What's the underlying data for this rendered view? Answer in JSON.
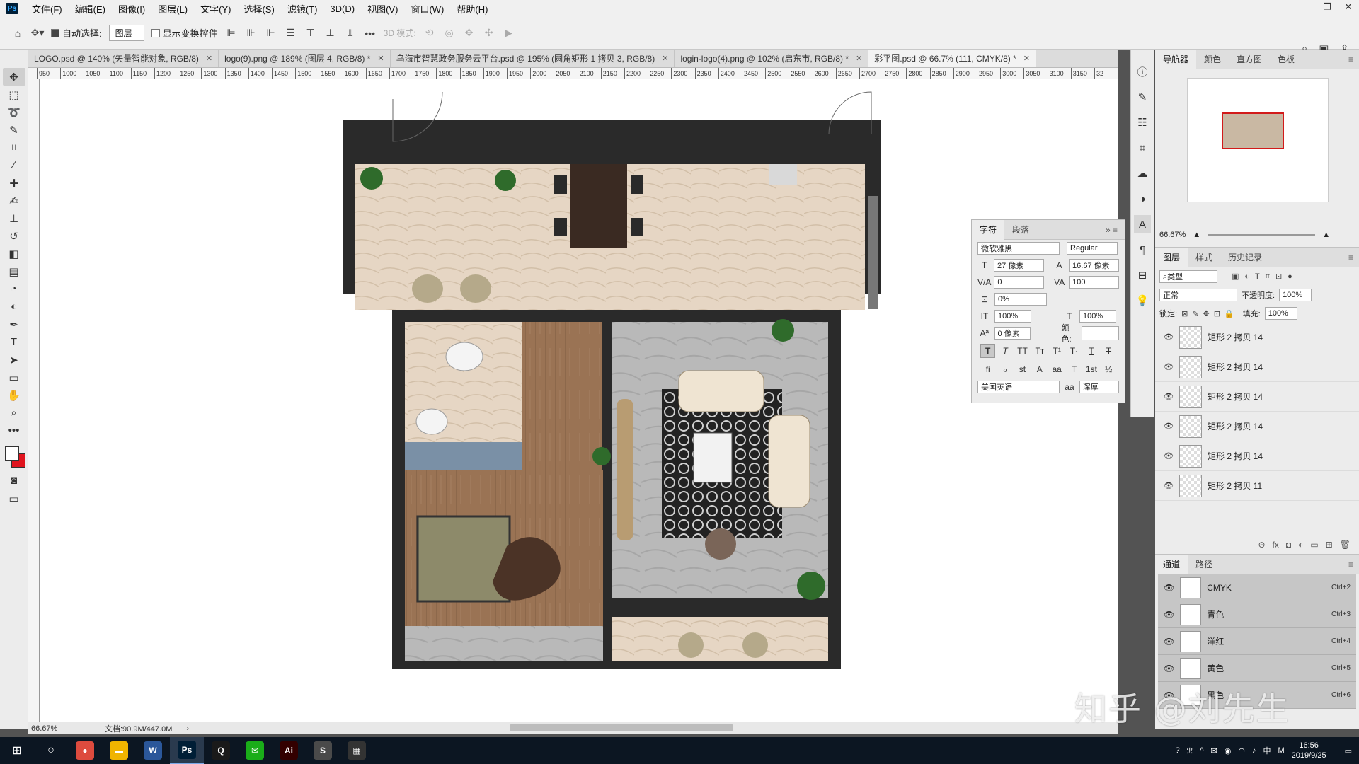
{
  "menubar": {
    "items": [
      "文件(F)",
      "编辑(E)",
      "图像(I)",
      "图层(L)",
      "文字(Y)",
      "选择(S)",
      "滤镜(T)",
      "3D(D)",
      "视图(V)",
      "窗口(W)",
      "帮助(H)"
    ]
  },
  "optionsbar": {
    "auto_select_label": "自动选择:",
    "auto_select_value": "图层",
    "show_transform_label": "显示变换控件",
    "mode_3d_label": "3D 模式:"
  },
  "doc_tabs": [
    {
      "label": "LOGO.psd @ 140% (矢量智能对象, RGB/8)"
    },
    {
      "label": "logo(9).png @ 189% (图层 4, RGB/8) *"
    },
    {
      "label": "乌海市智慧政务服务云平台.psd @ 195% (圆角矩形 1 拷贝 3, RGB/8)"
    },
    {
      "label": "login-logo(4).png @ 102% (启东市, RGB/8) *"
    },
    {
      "label": "彩平图.psd @ 66.7% (111, CMYK/8) *"
    }
  ],
  "ruler_labels": [
    "950",
    "1000",
    "1050",
    "1100",
    "1150",
    "1200",
    "1250",
    "1300",
    "1350",
    "1400",
    "1450",
    "1500",
    "1550",
    "1600",
    "1650",
    "1700",
    "1750",
    "1800",
    "1850",
    "1900",
    "1950",
    "2000",
    "2050",
    "2100",
    "2150",
    "2200",
    "2250",
    "2300",
    "2350",
    "2400",
    "2450",
    "2500",
    "2550",
    "2600",
    "2650",
    "2700",
    "2750",
    "2800",
    "2850",
    "2900",
    "2950",
    "3000",
    "3050",
    "3100",
    "3150",
    "32"
  ],
  "status": {
    "zoom": "66.67%",
    "doc": "文档:90.9M/447.0M"
  },
  "character_panel": {
    "tabs": [
      "字符",
      "段落"
    ],
    "font_family": "微软雅黑",
    "font_style": "Regular",
    "font_size": "27 像素",
    "leading": "16.67 像素",
    "kerning": "0",
    "tracking": "100",
    "scale_pct": "0%",
    "vscale": "100%",
    "hscale": "100%",
    "baseline": "0 像素",
    "color_label": "颜色:",
    "language": "美国英语",
    "antialias_icon": "aa",
    "antialias": "浑厚"
  },
  "navigator": {
    "tabs": [
      "导航器",
      "颜色",
      "直方图",
      "色板"
    ],
    "zoom": "66.67%"
  },
  "layers_panel": {
    "tabs": [
      "图层",
      "样式",
      "历史记录"
    ],
    "filter": "类型",
    "blend": "正常",
    "opacity_label": "不透明度:",
    "opacity": "100%",
    "lock_label": "锁定:",
    "fill_label": "填充:",
    "fill": "100%",
    "layers": [
      {
        "name": "矩形 2 拷贝 14"
      },
      {
        "name": "矩形 2 拷贝 14"
      },
      {
        "name": "矩形 2 拷贝 14"
      },
      {
        "name": "矩形 2 拷贝 14"
      },
      {
        "name": "矩形 2 拷贝 14"
      },
      {
        "name": "矩形 2 拷贝 11"
      }
    ]
  },
  "channels_panel": {
    "tabs": [
      "通道",
      "路径"
    ],
    "channels": [
      {
        "name": "CMYK",
        "shortcut": "Ctrl+2"
      },
      {
        "name": "青色",
        "shortcut": "Ctrl+3"
      },
      {
        "name": "洋红",
        "shortcut": "Ctrl+4"
      },
      {
        "name": "黄色",
        "shortcut": "Ctrl+5"
      },
      {
        "name": "黑色",
        "shortcut": "Ctrl+6"
      }
    ]
  },
  "taskbar": {
    "apps": [
      {
        "name": "chrome",
        "glyph": "●",
        "color": "#dd4b3e"
      },
      {
        "name": "explorer",
        "glyph": "▬",
        "color": "#f0b400"
      },
      {
        "name": "word",
        "glyph": "W",
        "color": "#2b579a"
      },
      {
        "name": "photoshop",
        "glyph": "Ps",
        "color": "#001e36"
      },
      {
        "name": "qq",
        "glyph": "Q",
        "color": "#1a1a1a"
      },
      {
        "name": "wechat",
        "glyph": "✉",
        "color": "#1aad19"
      },
      {
        "name": "illustrator",
        "glyph": "Ai",
        "color": "#330000"
      },
      {
        "name": "sublime",
        "glyph": "S",
        "color": "#4a4a4a"
      },
      {
        "name": "calculator",
        "glyph": "▦",
        "color": "#333333"
      }
    ],
    "time": "16:56",
    "date": "2019/9/25",
    "ime": "中"
  },
  "watermark": "知乎 @刘先生",
  "colors": {
    "accent_red": "#d21a1a",
    "ps_blue": "#31a8ff"
  }
}
